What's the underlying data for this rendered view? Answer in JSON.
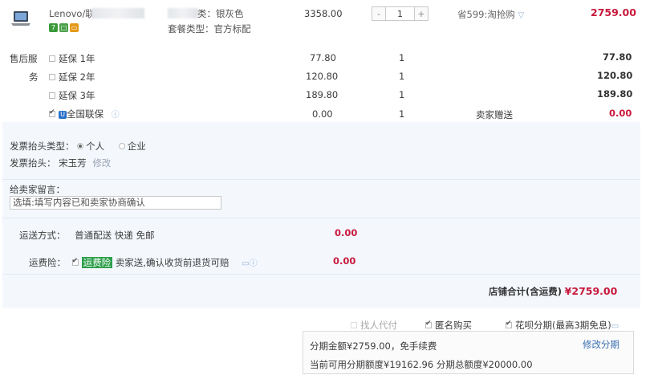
{
  "product": {
    "name_line1": "Lenovo/联",
    "color_label": "类：",
    "color_value": "银灰色",
    "set_label": "套餐类型：",
    "set_value": "官方标配",
    "price": "3358.00",
    "quantity": "1",
    "discount": "省599:淘抢购",
    "subtotal": "2759.00"
  },
  "after_sales": {
    "label_line1": "售后服",
    "label_line2": "务",
    "items": [
      {
        "label": "延保 1年",
        "price": "77.80",
        "qty": "1",
        "note": "",
        "total": "77.80",
        "checked": false
      },
      {
        "label": "延保 2年",
        "price": "120.80",
        "qty": "1",
        "note": "",
        "total": "120.80",
        "checked": false
      },
      {
        "label": "延保 3年",
        "price": "189.80",
        "qty": "1",
        "note": "",
        "total": "189.80",
        "checked": false
      },
      {
        "label": "全国联保",
        "price": "0.00",
        "qty": "1",
        "note": "卖家赠送",
        "total": "0.00",
        "checked": true
      }
    ]
  },
  "invoice": {
    "type_label": "发票抬头类型：",
    "option_personal": "个人",
    "option_company": "企业",
    "title_label": "发票抬头：",
    "title_value": "宋玉芳",
    "edit_link": "修改"
  },
  "message": {
    "label": "给卖家留言：",
    "value": "选填:填写内容已和卖家协商确认"
  },
  "shipping": {
    "label": "运送方式：",
    "value": "普通配送 快递 免邮",
    "fee": "0.00"
  },
  "insurance": {
    "label": "运费险：",
    "tag": "运费险",
    "text": "卖家送,确认收货前退货可赔",
    "fee": "0.00"
  },
  "store_total": {
    "label": "店铺合计(含运费)",
    "value": "¥2759.00"
  },
  "options": {
    "proxy_pay": "找人代付",
    "anonymous": "匿名购买",
    "installment": "花呗分期(最高3期免息)"
  },
  "installment_info": {
    "line1": "分期金额¥2759.00，免手续费",
    "line2": "当前可用分期额度¥19162.96 分期总额度¥20000.00",
    "modify_link": "修改分期"
  },
  "colors": {
    "accent_red": "#c8193c",
    "panel_bg": "#f4f8fd",
    "tag_green": "#2e9f4b"
  }
}
